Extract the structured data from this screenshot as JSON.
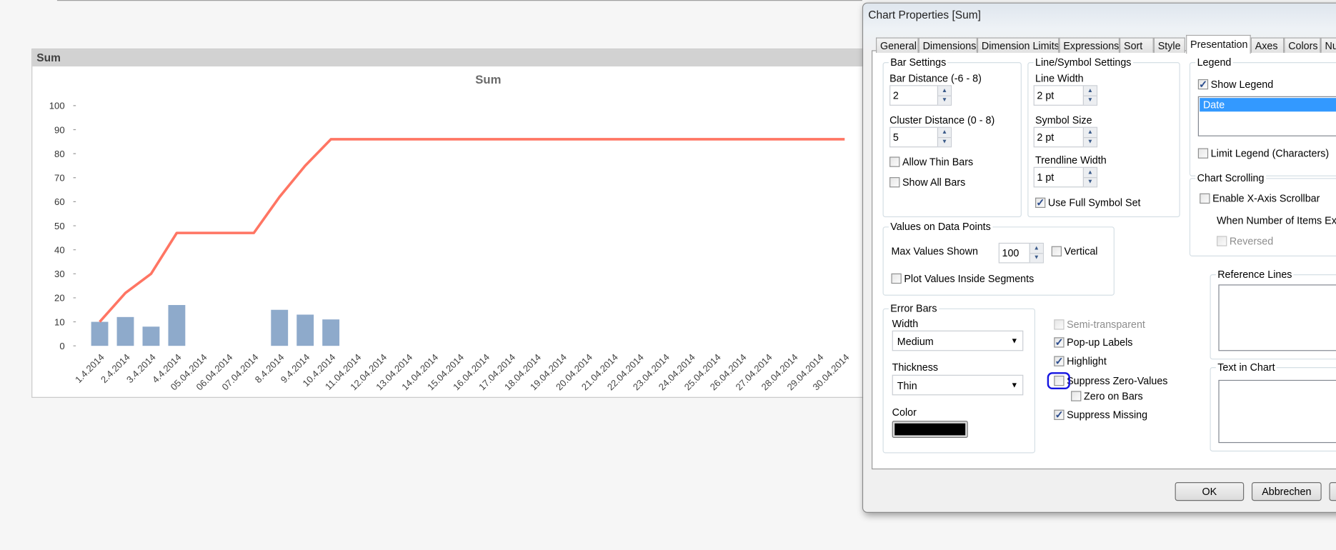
{
  "panel": {
    "title": "Sum"
  },
  "chart_data": {
    "type": "bar+line",
    "title": "Sum",
    "xlabel": "",
    "ylabel": "",
    "ylim": [
      0,
      100
    ],
    "yticks": [
      0,
      10,
      20,
      30,
      40,
      50,
      60,
      70,
      80,
      90,
      100
    ],
    "grid": false,
    "categories": [
      "1.4.2014",
      "2.4.2014",
      "3.4.2014",
      "4.4.2014",
      "05.04.2014",
      "06.04.2014",
      "07.04.2014",
      "8.4.2014",
      "9.4.2014",
      "10.4.2014",
      "11.04.2014",
      "12.04.2014",
      "13.04.2014",
      "14.04.2014",
      "15.04.2014",
      "16.04.2014",
      "17.04.2014",
      "18.04.2014",
      "19.04.2014",
      "20.04.2014",
      "21.04.2014",
      "22.04.2014",
      "23.04.2014",
      "24.04.2014",
      "25.04.2014",
      "26.04.2014",
      "27.04.2014",
      "28.04.2014",
      "29.04.2014",
      "30.04.2014"
    ],
    "series": [
      {
        "type": "bar",
        "color": "#8eaacb",
        "values": [
          10,
          12,
          8,
          17,
          null,
          null,
          null,
          15,
          13,
          11,
          null,
          null,
          null,
          null,
          null,
          null,
          null,
          null,
          null,
          null,
          null,
          null,
          null,
          null,
          null,
          null,
          null,
          null,
          null,
          null
        ]
      },
      {
        "type": "line",
        "color": "#ff7563",
        "values": [
          10,
          22,
          30,
          47,
          47,
          47,
          47,
          62,
          75,
          86,
          86,
          86,
          86,
          86,
          86,
          86,
          86,
          86,
          86,
          86,
          86,
          86,
          86,
          86,
          86,
          86,
          86,
          86,
          86,
          86
        ]
      }
    ]
  },
  "dialog": {
    "title": "Chart Properties [Sum]",
    "tabs": [
      "General",
      "Dimensions",
      "Dimension Limits",
      "Expressions",
      "Sort",
      "Style",
      "Presentation",
      "Axes",
      "Colors",
      "Nu"
    ],
    "active_tab": "Presentation",
    "bar_settings": {
      "legend": "Bar Settings",
      "bar_distance_label": "Bar Distance (-6 - 8)",
      "bar_distance": "2",
      "cluster_distance_label": "Cluster Distance (0 - 8)",
      "cluster_distance": "5",
      "allow_thin_bars": "Allow Thin Bars",
      "show_all_bars": "Show All Bars"
    },
    "line_settings": {
      "legend": "Line/Symbol Settings",
      "line_width_label": "Line Width",
      "line_width": "2 pt",
      "symbol_size_label": "Symbol Size",
      "symbol_size": "2 pt",
      "trendline_width_label": "Trendline Width",
      "trendline_width": "1 pt",
      "use_full_symbol_set": "Use Full Symbol Set"
    },
    "values_on_points": {
      "legend": "Values on Data Points",
      "max_values_label": "Max Values Shown",
      "max_values": "100",
      "vertical": "Vertical",
      "plot_inside": "Plot Values Inside Segments"
    },
    "error_bars": {
      "legend": "Error Bars",
      "width_label": "Width",
      "width": "Medium",
      "thickness_label": "Thickness",
      "thickness": "Thin",
      "color_label": "Color",
      "color": "#000000"
    },
    "options": {
      "semi_transparent": "Semi-transparent",
      "popup_labels": "Pop-up Labels",
      "highlight": "Highlight",
      "suppress_zero": "Suppress Zero-Values",
      "zero_on_bars": "Zero on Bars",
      "suppress_missing": "Suppress Missing"
    },
    "legend_group": {
      "legend": "Legend",
      "show_legend": "Show Legend",
      "items": [
        "Date"
      ],
      "limit_legend": "Limit Legend (Characters)"
    },
    "scrolling": {
      "legend": "Chart Scrolling",
      "enable": "Enable X-Axis Scrollbar",
      "when_exceeds": "When Number of Items Exce",
      "reversed": "Reversed"
    },
    "reference_lines": {
      "legend": "Reference Lines"
    },
    "text_in_chart": {
      "legend": "Text in Chart"
    },
    "buttons": {
      "ok": "OK",
      "cancel": "Abbrechen"
    },
    "selection_color": "#3399ff",
    "annotation_color": "#1515e0"
  }
}
